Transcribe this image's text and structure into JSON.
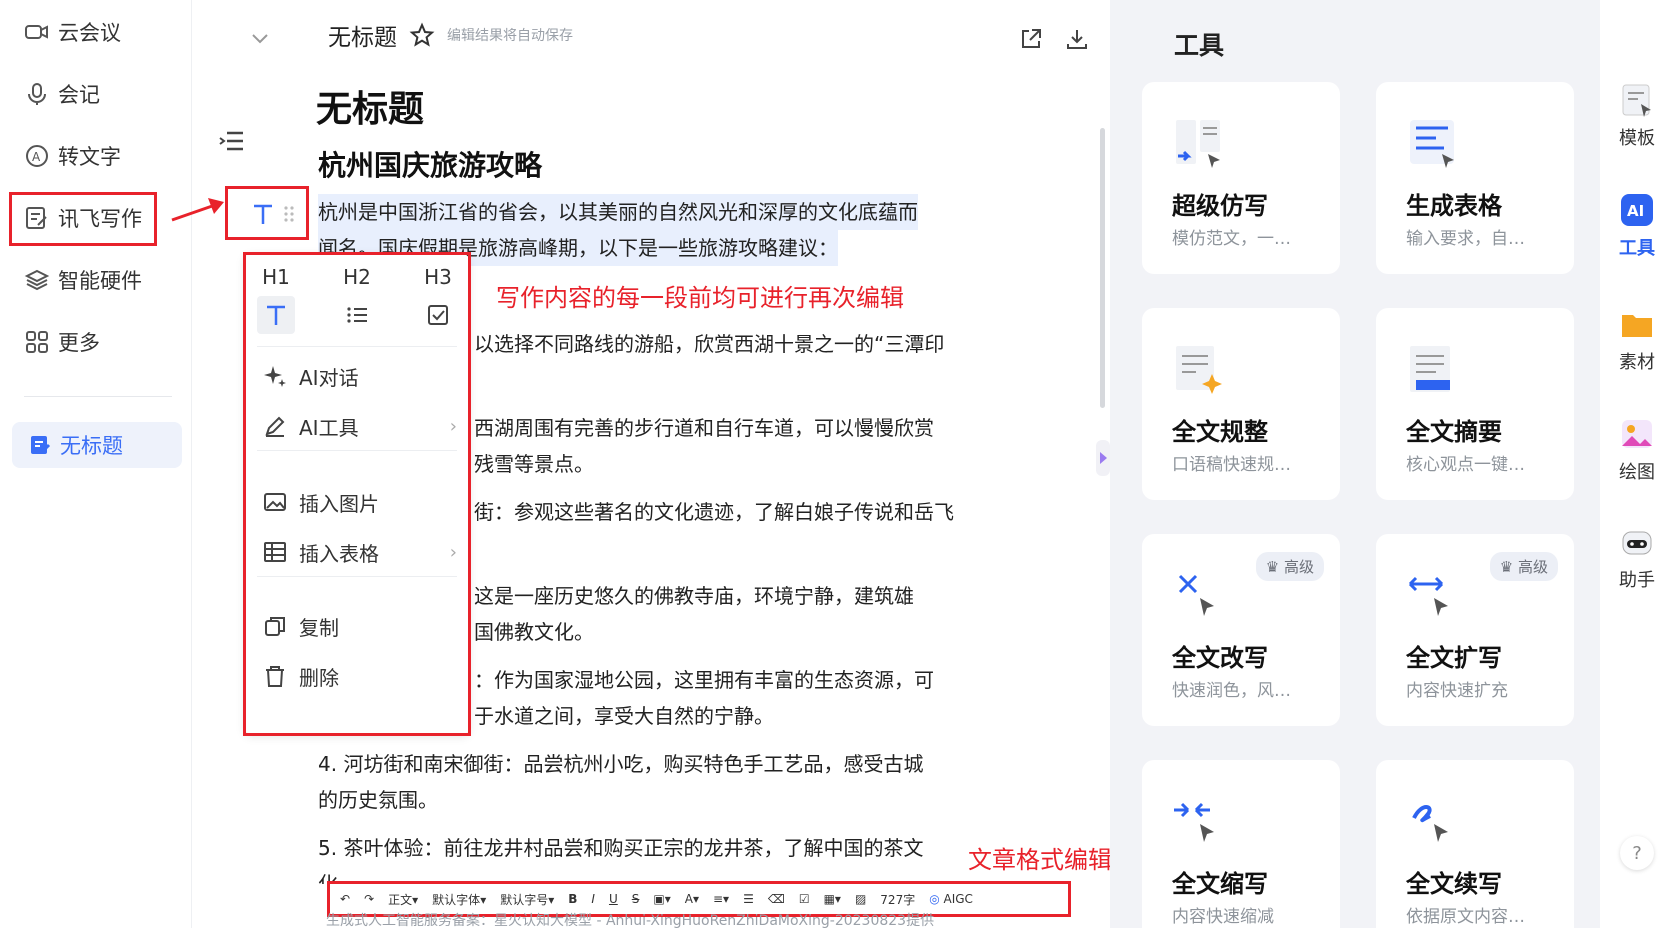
{
  "sidebar": {
    "items": [
      {
        "label": "云会议",
        "icon": "video-icon"
      },
      {
        "label": "会记",
        "icon": "mic-icon"
      },
      {
        "label": "转文字",
        "icon": "transcribe-icon"
      },
      {
        "label": "讯飞写作",
        "icon": "write-icon"
      },
      {
        "label": "智能硬件",
        "icon": "layers-icon"
      },
      {
        "label": "更多",
        "icon": "grid-icon"
      }
    ],
    "active_doc": "无标题"
  },
  "header": {
    "title": "无标题",
    "autosave_hint": "编辑结果将自动保存"
  },
  "document": {
    "title": "无标题",
    "heading": "杭州国庆旅游攻略",
    "paragraphs": [
      "杭州是中国浙江省的省会，以其美丽的自然风光和深厚的文化底蕴而",
      "闻名。国庆假期是旅游高峰期，以下是一些旅游攻略建议：",
      "以选择不同路线的游船，欣赏西湖十景之一的“三潭印",
      "西湖周围有完善的步行道和自行车道，可以慢慢欣赏",
      "残雪等景点。",
      "街：参观这些著名的文化遗迹，了解白娘子传说和岳飞",
      "这是一座历史悠久的佛教寺庙，环境宁静，建筑雄",
      "国佛教文化。",
      "：作为国家湿地公园，这里拥有丰富的生态资源，可",
      "于水道之间，享受大自然的宁静。",
      "4. 河坊街和南宋御街：品尝杭州小吃，购买特色手工艺品，感受古城",
      "的历史氛围。",
      "5. 茶叶体验：前往龙井村品尝和购买正宗的龙井茶，了解中国的茶文",
      "化。"
    ]
  },
  "block_menu": {
    "headings": [
      "H1",
      "H2",
      "H3"
    ],
    "items": [
      {
        "label": "AI对话",
        "icon": "sparkle-icon"
      },
      {
        "label": "AI工具",
        "icon": "pen-icon",
        "has_submenu": true
      },
      {
        "label": "插入图片",
        "icon": "image-icon"
      },
      {
        "label": "插入表格",
        "icon": "table-icon",
        "has_submenu": true
      },
      {
        "label": "复制",
        "icon": "copy-icon"
      },
      {
        "label": "删除",
        "icon": "trash-icon"
      }
    ]
  },
  "annotations": {
    "block_edit": "写作内容的每一段前均可进行再次编辑",
    "toolbar": "文章格式编辑栏"
  },
  "toolbar": {
    "paragraph_style": "正文",
    "font_family": "默认字体",
    "font_size": "默认字号",
    "word_count": "727字",
    "aigc": "AIGC"
  },
  "footer_text": "生成式人工智能服务备案：星火认知大模型 - Anhui-XingHuoRenZhiDaMoXing-20230823提供",
  "tools": {
    "title": "工具",
    "cards": [
      {
        "name": "超级仿写",
        "desc": "模仿范文，一…",
        "premium": false
      },
      {
        "name": "生成表格",
        "desc": "输入要求，自…",
        "premium": false
      },
      {
        "name": "全文规整",
        "desc": "口语稿快速规…",
        "premium": false
      },
      {
        "name": "全文摘要",
        "desc": "核心观点一键…",
        "premium": false
      },
      {
        "name": "全文改写",
        "desc": "快速润色，风…",
        "premium": true
      },
      {
        "name": "全文扩写",
        "desc": "内容快速扩充",
        "premium": true
      },
      {
        "name": "全文缩写",
        "desc": "内容快速缩减",
        "premium": false
      },
      {
        "name": "全文续写",
        "desc": "依据原文内容…",
        "premium": false
      }
    ],
    "badge_label": "高级"
  },
  "rail": {
    "items": [
      "模板",
      "工具",
      "素材",
      "绘图",
      "助手"
    ],
    "active": "工具",
    "ai_label": "AI",
    "help": "?"
  },
  "colors": {
    "accent": "#3a6ef6",
    "annotation": "#e8222b"
  }
}
